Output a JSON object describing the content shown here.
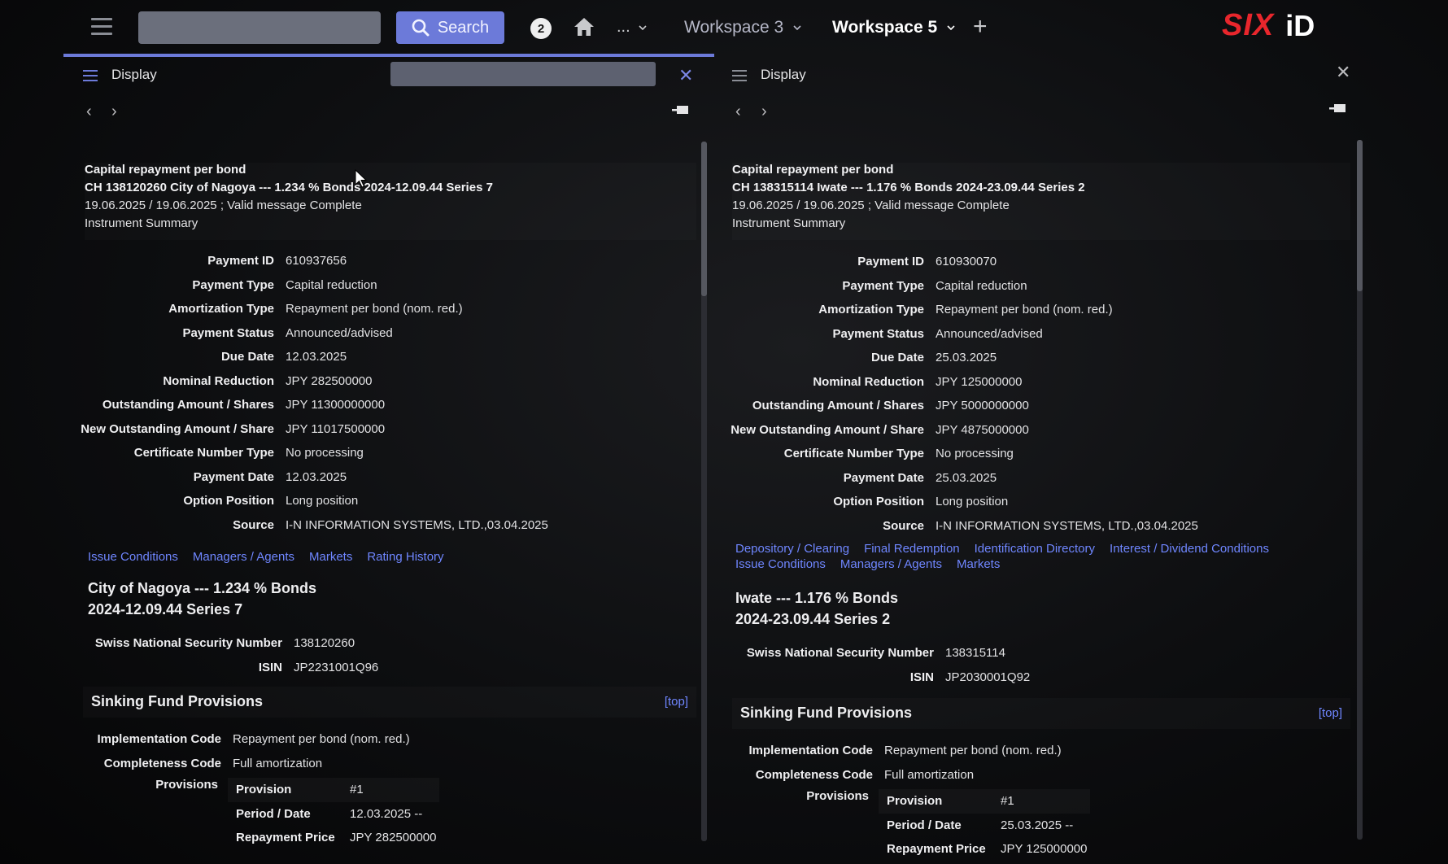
{
  "topbar": {
    "search_button_label": "Search",
    "notification_count": "2",
    "more_label": "...",
    "workspaces": [
      {
        "label": "Workspace 3",
        "active": false
      },
      {
        "label": "Workspace 5",
        "active": true
      }
    ],
    "add_label": "+",
    "logo_six": "SIX",
    "logo_id": "iD"
  },
  "left": {
    "panel_title": "Display",
    "summary": {
      "line1": "Capital repayment per bond",
      "line2": "CH 138120260 City of Nagoya --- 1.234 % Bonds 2024-12.09.44 Series 7",
      "line3": "19.06.2025 / 19.06.2025 ;  Valid message Complete",
      "line4": "Instrument Summary"
    },
    "fields": [
      {
        "label": "Payment ID",
        "value": "610937656"
      },
      {
        "label": "Payment Type",
        "value": "Capital reduction"
      },
      {
        "label": "Amortization Type",
        "value": "Repayment per bond (nom. red.)"
      },
      {
        "label": "Payment Status",
        "value": "Announced/advised"
      },
      {
        "label": "Due Date",
        "value": "12.03.2025"
      },
      {
        "label": "Nominal Reduction",
        "value": "JPY 282500000"
      },
      {
        "label": "Outstanding Amount / Shares",
        "value": "JPY 11300000000"
      },
      {
        "label": "New Outstanding Amount / Share",
        "value": "JPY 11017500000"
      },
      {
        "label": "Certificate Number Type",
        "value": "No processing"
      },
      {
        "label": "Payment Date",
        "value": "12.03.2025"
      },
      {
        "label": "Option Position",
        "value": "Long position"
      },
      {
        "label": "Source",
        "value": "I-N INFORMATION SYSTEMS, LTD.,03.04.2025"
      }
    ],
    "links": [
      "Issue Conditions",
      "Managers / Agents",
      "Markets",
      "Rating History"
    ],
    "bond_title_1": "City of Nagoya --- 1.234 % Bonds",
    "bond_title_2": "2024-12.09.44 Series 7",
    "ids": [
      {
        "label": "Swiss National Security Number",
        "value": "138120260"
      },
      {
        "label": "ISIN",
        "value": "JP2231001Q96"
      }
    ],
    "section_title": "Sinking Fund Provisions",
    "top_link": "[top]",
    "codes": [
      {
        "label": "Implementation Code",
        "value": "Repayment per bond (nom. red.)"
      },
      {
        "label": "Completeness Code",
        "value": "Full amortization"
      }
    ],
    "provisions_label": "Provisions",
    "provisions": [
      {
        "label": "Provision",
        "value": "#1"
      },
      {
        "label": "Period / Date",
        "value": "12.03.2025 --"
      },
      {
        "label": "Repayment Price",
        "value": "JPY 282500000"
      }
    ]
  },
  "right": {
    "panel_title": "Display",
    "summary": {
      "line1": "Capital repayment per bond",
      "line2": "CH 138315114 Iwate --- 1.176 % Bonds 2024-23.09.44 Series 2",
      "line3": "19.06.2025 / 19.06.2025 ;  Valid message Complete",
      "line4": "Instrument Summary"
    },
    "fields": [
      {
        "label": "Payment ID",
        "value": "610930070"
      },
      {
        "label": "Payment Type",
        "value": "Capital reduction"
      },
      {
        "label": "Amortization Type",
        "value": "Repayment per bond (nom. red.)"
      },
      {
        "label": "Payment Status",
        "value": "Announced/advised"
      },
      {
        "label": "Due Date",
        "value": "25.03.2025"
      },
      {
        "label": "Nominal Reduction",
        "value": "JPY 125000000"
      },
      {
        "label": "Outstanding Amount / Shares",
        "value": "JPY 5000000000"
      },
      {
        "label": "New Outstanding Amount / Share",
        "value": "JPY 4875000000"
      },
      {
        "label": "Certificate Number Type",
        "value": "No processing"
      },
      {
        "label": "Payment Date",
        "value": "25.03.2025"
      },
      {
        "label": "Option Position",
        "value": "Long position"
      },
      {
        "label": "Source",
        "value": "I-N INFORMATION SYSTEMS, LTD.,03.04.2025"
      }
    ],
    "links": [
      "Depository / Clearing",
      "Final Redemption",
      "Identification Directory",
      "Interest / Dividend Conditions",
      "Issue Conditions",
      "Managers / Agents",
      "Markets"
    ],
    "bond_title_1": "Iwate --- 1.176 % Bonds",
    "bond_title_2": "2024-23.09.44 Series 2",
    "ids": [
      {
        "label": "Swiss National Security Number",
        "value": "138315114"
      },
      {
        "label": "ISIN",
        "value": "JP2030001Q92"
      }
    ],
    "section_title": "Sinking Fund Provisions",
    "top_link": "[top]",
    "codes": [
      {
        "label": "Implementation Code",
        "value": "Repayment per bond (nom. red.)"
      },
      {
        "label": "Completeness Code",
        "value": "Full amortization"
      }
    ],
    "provisions_label": "Provisions",
    "provisions": [
      {
        "label": "Provision",
        "value": "#1"
      },
      {
        "label": "Period / Date",
        "value": "25.03.2025 --"
      },
      {
        "label": "Repayment Price",
        "value": "JPY 125000000"
      }
    ]
  },
  "colors": {
    "accent": "#6c7ad9",
    "link": "#6f86ff",
    "brand_red": "#e8262c",
    "background": "#0d0e10"
  }
}
